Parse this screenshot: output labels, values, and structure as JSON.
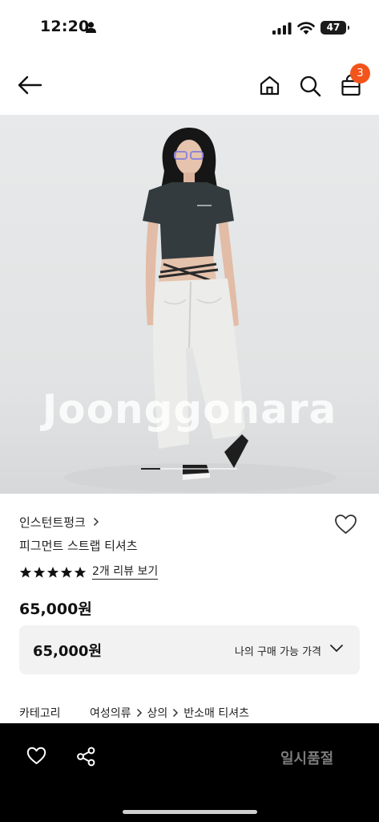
{
  "status_bar": {
    "time": "12:20",
    "battery": "47"
  },
  "header": {
    "cart_count": "3"
  },
  "hero": {
    "watermark": "Joonggonara",
    "slide_current": 1
  },
  "product": {
    "brand": "인스턴트펑크",
    "name": "피그먼트 스트랩 티셔츠",
    "rating_stars": 5,
    "review_link": "2개 리뷰 보기",
    "price": "65,000원"
  },
  "price_selector": {
    "value": "65,000원",
    "label": "나의 구매 가능 가격"
  },
  "category": {
    "label": "카테고리",
    "crumbs": [
      "여성의류",
      "상의",
      "반소매 티셔츠"
    ]
  },
  "bottom_bar": {
    "status_label": "일시품절"
  },
  "colors": {
    "accent_badge": "#f2541b",
    "bottom_bar": "#000000",
    "price_box_bg": "#f2f2f2"
  }
}
